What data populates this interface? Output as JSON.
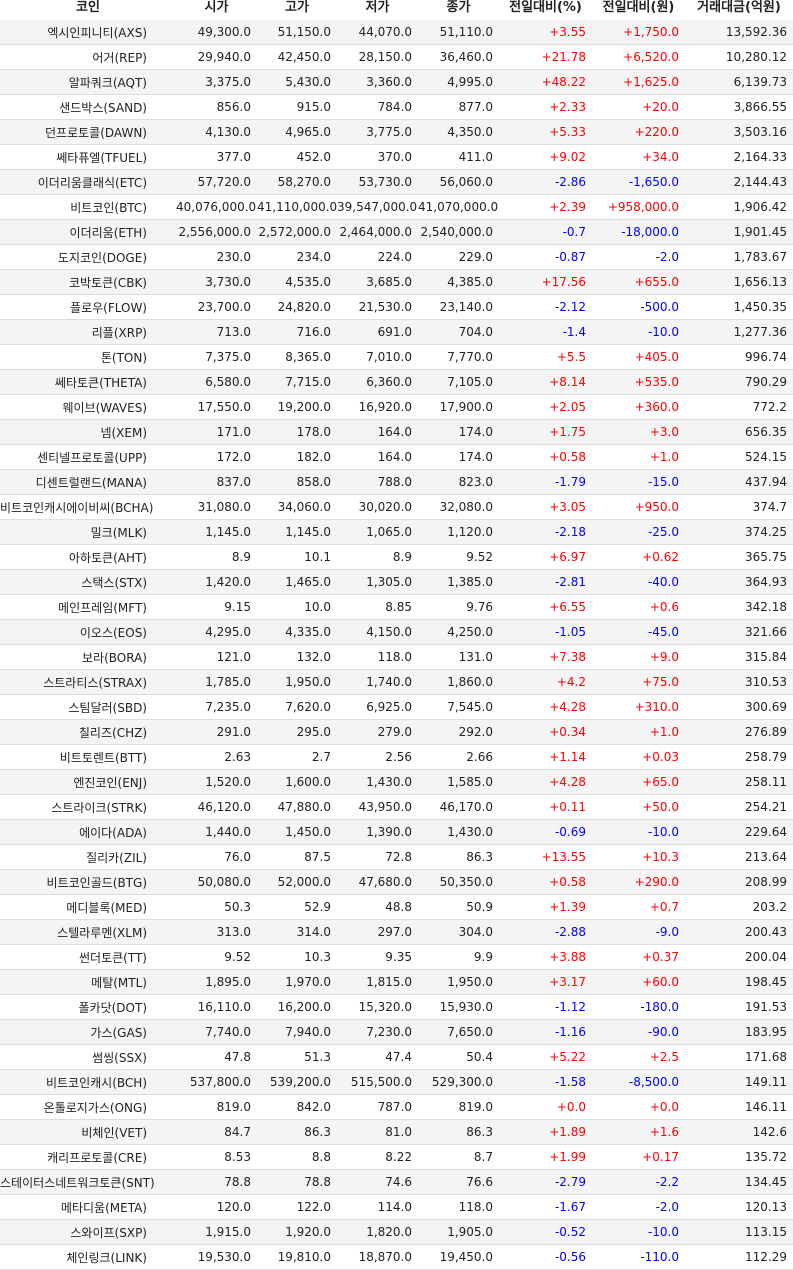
{
  "headers": [
    "코인",
    "시가",
    "고가",
    "저가",
    "종가",
    "전일대비(%)",
    "전일대비(원)",
    "거래대금(억원)"
  ],
  "colors": {
    "up": "#ff0000",
    "down": "#0000ff",
    "stripe": "#f4f4f4",
    "text": "#222222"
  },
  "rows": [
    {
      "name": "엑시인피니티(AXS)",
      "open": "49,300.0",
      "high": "51,150.0",
      "low": "44,070.0",
      "close": "51,110.0",
      "pct": "+3.55",
      "diff": "+1,750.0",
      "volume": "13,592.36"
    },
    {
      "name": "어거(REP)",
      "open": "29,940.0",
      "high": "42,450.0",
      "low": "28,150.0",
      "close": "36,460.0",
      "pct": "+21.78",
      "diff": "+6,520.0",
      "volume": "10,280.12"
    },
    {
      "name": "알파쿼크(AQT)",
      "open": "3,375.0",
      "high": "5,430.0",
      "low": "3,360.0",
      "close": "4,995.0",
      "pct": "+48.22",
      "diff": "+1,625.0",
      "volume": "6,139.73"
    },
    {
      "name": "샌드박스(SAND)",
      "open": "856.0",
      "high": "915.0",
      "low": "784.0",
      "close": "877.0",
      "pct": "+2.33",
      "diff": "+20.0",
      "volume": "3,866.55"
    },
    {
      "name": "던프로토콜(DAWN)",
      "open": "4,130.0",
      "high": "4,965.0",
      "low": "3,775.0",
      "close": "4,350.0",
      "pct": "+5.33",
      "diff": "+220.0",
      "volume": "3,503.16"
    },
    {
      "name": "쎄타퓨엘(TFUEL)",
      "open": "377.0",
      "high": "452.0",
      "low": "370.0",
      "close": "411.0",
      "pct": "+9.02",
      "diff": "+34.0",
      "volume": "2,164.33"
    },
    {
      "name": "이더리움클래식(ETC)",
      "open": "57,720.0",
      "high": "58,270.0",
      "low": "53,730.0",
      "close": "56,060.0",
      "pct": "-2.86",
      "diff": "-1,650.0",
      "volume": "2,144.43"
    },
    {
      "name": "비트코인(BTC)",
      "open": "40,076,000.0",
      "high": "41,110,000.0",
      "low": "39,547,000.0",
      "close": "41,070,000.0",
      "pct": "+2.39",
      "diff": "+958,000.0",
      "volume": "1,906.42"
    },
    {
      "name": "이더리움(ETH)",
      "open": "2,556,000.0",
      "high": "2,572,000.0",
      "low": "2,464,000.0",
      "close": "2,540,000.0",
      "pct": "-0.7",
      "diff": "-18,000.0",
      "volume": "1,901.45"
    },
    {
      "name": "도지코인(DOGE)",
      "open": "230.0",
      "high": "234.0",
      "low": "224.0",
      "close": "229.0",
      "pct": "-0.87",
      "diff": "-2.0",
      "volume": "1,783.67"
    },
    {
      "name": "코박토큰(CBK)",
      "open": "3,730.0",
      "high": "4,535.0",
      "low": "3,685.0",
      "close": "4,385.0",
      "pct": "+17.56",
      "diff": "+655.0",
      "volume": "1,656.13"
    },
    {
      "name": "플로우(FLOW)",
      "open": "23,700.0",
      "high": "24,820.0",
      "low": "21,530.0",
      "close": "23,140.0",
      "pct": "-2.12",
      "diff": "-500.0",
      "volume": "1,450.35"
    },
    {
      "name": "리플(XRP)",
      "open": "713.0",
      "high": "716.0",
      "low": "691.0",
      "close": "704.0",
      "pct": "-1.4",
      "diff": "-10.0",
      "volume": "1,277.36"
    },
    {
      "name": "톤(TON)",
      "open": "7,375.0",
      "high": "8,365.0",
      "low": "7,010.0",
      "close": "7,770.0",
      "pct": "+5.5",
      "diff": "+405.0",
      "volume": "996.74"
    },
    {
      "name": "쎄타토큰(THETA)",
      "open": "6,580.0",
      "high": "7,715.0",
      "low": "6,360.0",
      "close": "7,105.0",
      "pct": "+8.14",
      "diff": "+535.0",
      "volume": "790.29"
    },
    {
      "name": "웨이브(WAVES)",
      "open": "17,550.0",
      "high": "19,200.0",
      "low": "16,920.0",
      "close": "17,900.0",
      "pct": "+2.05",
      "diff": "+360.0",
      "volume": "772.2"
    },
    {
      "name": "넴(XEM)",
      "open": "171.0",
      "high": "178.0",
      "low": "164.0",
      "close": "174.0",
      "pct": "+1.75",
      "diff": "+3.0",
      "volume": "656.35"
    },
    {
      "name": "센티넬프로토콜(UPP)",
      "open": "172.0",
      "high": "182.0",
      "low": "164.0",
      "close": "174.0",
      "pct": "+0.58",
      "diff": "+1.0",
      "volume": "524.15"
    },
    {
      "name": "디센트럴랜드(MANA)",
      "open": "837.0",
      "high": "858.0",
      "low": "788.0",
      "close": "823.0",
      "pct": "-1.79",
      "diff": "-15.0",
      "volume": "437.94"
    },
    {
      "name": "비트코인캐시에이비씨(BCHA)",
      "open": "31,080.0",
      "high": "34,060.0",
      "low": "30,020.0",
      "close": "32,080.0",
      "pct": "+3.05",
      "diff": "+950.0",
      "volume": "374.7"
    },
    {
      "name": "밀크(MLK)",
      "open": "1,145.0",
      "high": "1,145.0",
      "low": "1,065.0",
      "close": "1,120.0",
      "pct": "-2.18",
      "diff": "-25.0",
      "volume": "374.25"
    },
    {
      "name": "아하토큰(AHT)",
      "open": "8.9",
      "high": "10.1",
      "low": "8.9",
      "close": "9.52",
      "pct": "+6.97",
      "diff": "+0.62",
      "volume": "365.75"
    },
    {
      "name": "스택스(STX)",
      "open": "1,420.0",
      "high": "1,465.0",
      "low": "1,305.0",
      "close": "1,385.0",
      "pct": "-2.81",
      "diff": "-40.0",
      "volume": "364.93"
    },
    {
      "name": "메인프레임(MFT)",
      "open": "9.15",
      "high": "10.0",
      "low": "8.85",
      "close": "9.76",
      "pct": "+6.55",
      "diff": "+0.6",
      "volume": "342.18"
    },
    {
      "name": "이오스(EOS)",
      "open": "4,295.0",
      "high": "4,335.0",
      "low": "4,150.0",
      "close": "4,250.0",
      "pct": "-1.05",
      "diff": "-45.0",
      "volume": "321.66"
    },
    {
      "name": "보라(BORA)",
      "open": "121.0",
      "high": "132.0",
      "low": "118.0",
      "close": "131.0",
      "pct": "+7.38",
      "diff": "+9.0",
      "volume": "315.84"
    },
    {
      "name": "스트라티스(STRAX)",
      "open": "1,785.0",
      "high": "1,950.0",
      "low": "1,740.0",
      "close": "1,860.0",
      "pct": "+4.2",
      "diff": "+75.0",
      "volume": "310.53"
    },
    {
      "name": "스팀달러(SBD)",
      "open": "7,235.0",
      "high": "7,620.0",
      "low": "6,925.0",
      "close": "7,545.0",
      "pct": "+4.28",
      "diff": "+310.0",
      "volume": "300.69"
    },
    {
      "name": "칠리즈(CHZ)",
      "open": "291.0",
      "high": "295.0",
      "low": "279.0",
      "close": "292.0",
      "pct": "+0.34",
      "diff": "+1.0",
      "volume": "276.89"
    },
    {
      "name": "비트토렌트(BTT)",
      "open": "2.63",
      "high": "2.7",
      "low": "2.56",
      "close": "2.66",
      "pct": "+1.14",
      "diff": "+0.03",
      "volume": "258.79"
    },
    {
      "name": "엔진코인(ENJ)",
      "open": "1,520.0",
      "high": "1,600.0",
      "low": "1,430.0",
      "close": "1,585.0",
      "pct": "+4.28",
      "diff": "+65.0",
      "volume": "258.11"
    },
    {
      "name": "스트라이크(STRK)",
      "open": "46,120.0",
      "high": "47,880.0",
      "low": "43,950.0",
      "close": "46,170.0",
      "pct": "+0.11",
      "diff": "+50.0",
      "volume": "254.21"
    },
    {
      "name": "에이다(ADA)",
      "open": "1,440.0",
      "high": "1,450.0",
      "low": "1,390.0",
      "close": "1,430.0",
      "pct": "-0.69",
      "diff": "-10.0",
      "volume": "229.64"
    },
    {
      "name": "질리카(ZIL)",
      "open": "76.0",
      "high": "87.5",
      "low": "72.8",
      "close": "86.3",
      "pct": "+13.55",
      "diff": "+10.3",
      "volume": "213.64"
    },
    {
      "name": "비트코인골드(BTG)",
      "open": "50,080.0",
      "high": "52,000.0",
      "low": "47,680.0",
      "close": "50,350.0",
      "pct": "+0.58",
      "diff": "+290.0",
      "volume": "208.99"
    },
    {
      "name": "메디블록(MED)",
      "open": "50.3",
      "high": "52.9",
      "low": "48.8",
      "close": "50.9",
      "pct": "+1.39",
      "diff": "+0.7",
      "volume": "203.2"
    },
    {
      "name": "스텔라루멘(XLM)",
      "open": "313.0",
      "high": "314.0",
      "low": "297.0",
      "close": "304.0",
      "pct": "-2.88",
      "diff": "-9.0",
      "volume": "200.43"
    },
    {
      "name": "썬더토큰(TT)",
      "open": "9.52",
      "high": "10.3",
      "low": "9.35",
      "close": "9.9",
      "pct": "+3.88",
      "diff": "+0.37",
      "volume": "200.04"
    },
    {
      "name": "메탈(MTL)",
      "open": "1,895.0",
      "high": "1,970.0",
      "low": "1,815.0",
      "close": "1,950.0",
      "pct": "+3.17",
      "diff": "+60.0",
      "volume": "198.45"
    },
    {
      "name": "폴카닷(DOT)",
      "open": "16,110.0",
      "high": "16,200.0",
      "low": "15,320.0",
      "close": "15,930.0",
      "pct": "-1.12",
      "diff": "-180.0",
      "volume": "191.53"
    },
    {
      "name": "가스(GAS)",
      "open": "7,740.0",
      "high": "7,940.0",
      "low": "7,230.0",
      "close": "7,650.0",
      "pct": "-1.16",
      "diff": "-90.0",
      "volume": "183.95"
    },
    {
      "name": "썸씽(SSX)",
      "open": "47.8",
      "high": "51.3",
      "low": "47.4",
      "close": "50.4",
      "pct": "+5.22",
      "diff": "+2.5",
      "volume": "171.68"
    },
    {
      "name": "비트코인캐시(BCH)",
      "open": "537,800.0",
      "high": "539,200.0",
      "low": "515,500.0",
      "close": "529,300.0",
      "pct": "-1.58",
      "diff": "-8,500.0",
      "volume": "149.11"
    },
    {
      "name": "온톨로지가스(ONG)",
      "open": "819.0",
      "high": "842.0",
      "low": "787.0",
      "close": "819.0",
      "pct": "+0.0",
      "diff": "+0.0",
      "volume": "146.11"
    },
    {
      "name": "비체인(VET)",
      "open": "84.7",
      "high": "86.3",
      "low": "81.0",
      "close": "86.3",
      "pct": "+1.89",
      "diff": "+1.6",
      "volume": "142.6"
    },
    {
      "name": "캐리프로토콜(CRE)",
      "open": "8.53",
      "high": "8.8",
      "low": "8.22",
      "close": "8.7",
      "pct": "+1.99",
      "diff": "+0.17",
      "volume": "135.72"
    },
    {
      "name": "스테이터스네트워크토큰(SNT)",
      "open": "78.8",
      "high": "78.8",
      "low": "74.6",
      "close": "76.6",
      "pct": "-2.79",
      "diff": "-2.2",
      "volume": "134.45"
    },
    {
      "name": "메타디움(META)",
      "open": "120.0",
      "high": "122.0",
      "low": "114.0",
      "close": "118.0",
      "pct": "-1.67",
      "diff": "-2.0",
      "volume": "120.13"
    },
    {
      "name": "스와이프(SXP)",
      "open": "1,915.0",
      "high": "1,920.0",
      "low": "1,820.0",
      "close": "1,905.0",
      "pct": "-0.52",
      "diff": "-10.0",
      "volume": "113.15"
    },
    {
      "name": "체인링크(LINK)",
      "open": "19,530.0",
      "high": "19,810.0",
      "low": "18,870.0",
      "close": "19,450.0",
      "pct": "-0.56",
      "diff": "-110.0",
      "volume": "112.29"
    }
  ]
}
